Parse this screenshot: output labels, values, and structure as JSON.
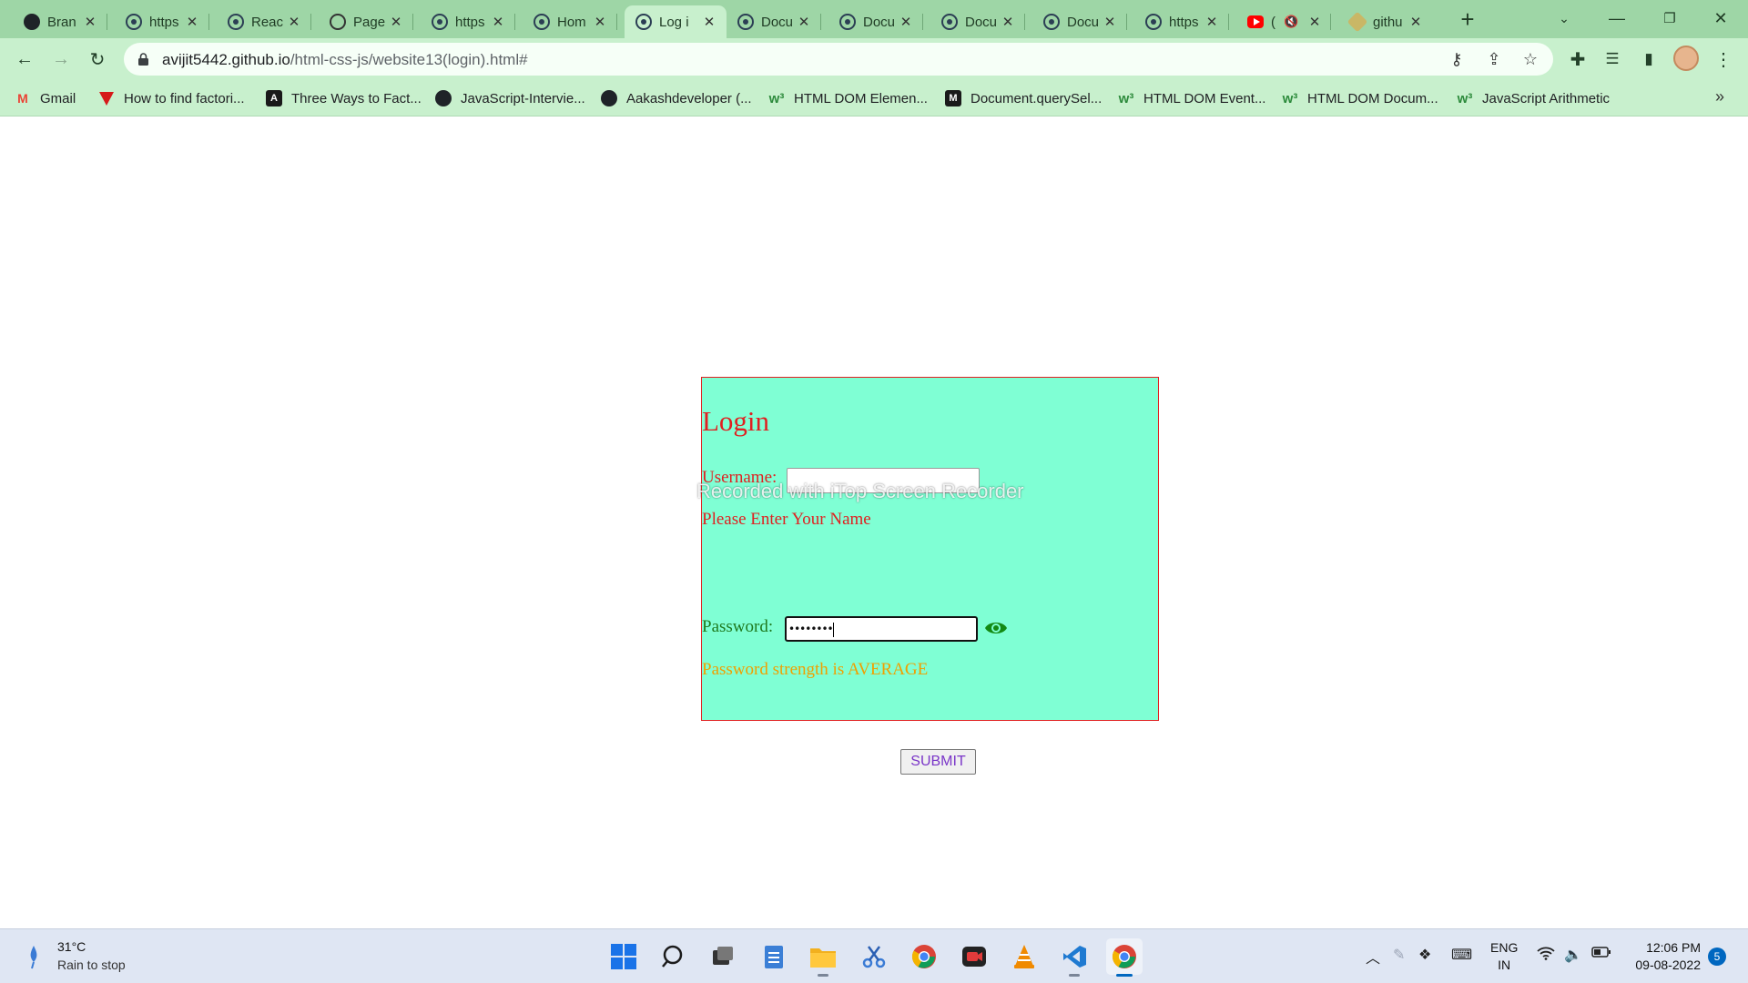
{
  "browser": {
    "tabs": [
      {
        "title": "Bran",
        "icon": "github-icon"
      },
      {
        "title": "https",
        "icon": "react-icon"
      },
      {
        "title": "Reac",
        "icon": "react-icon"
      },
      {
        "title": "Page",
        "icon": "globe-icon"
      },
      {
        "title": "https",
        "icon": "react-icon"
      },
      {
        "title": "Hom",
        "icon": "react-icon"
      },
      {
        "title": "Log i",
        "icon": "react-icon",
        "active": true
      },
      {
        "title": "Docu",
        "icon": "react-icon"
      },
      {
        "title": "Docu",
        "icon": "react-icon"
      },
      {
        "title": "Docu",
        "icon": "react-icon"
      },
      {
        "title": "Docu",
        "icon": "react-icon"
      },
      {
        "title": "https",
        "icon": "react-icon"
      },
      {
        "title": "(",
        "icon": "youtube-icon",
        "muted": true
      },
      {
        "title": "githu",
        "icon": "git-icon"
      }
    ],
    "new_tab": "+",
    "url_host": "avijit5442.github.io",
    "url_path": "/html-css-js/website13(login).html#",
    "bookmarks": [
      {
        "label": "Gmail",
        "icon": "gmail-icon"
      },
      {
        "label": "How to find factori...",
        "icon": "topcoder-icon"
      },
      {
        "label": "Three Ways to Fact...",
        "icon": "freecodecamp-icon"
      },
      {
        "label": "JavaScript-Intervie...",
        "icon": "github-icon"
      },
      {
        "label": "Aakashdeveloper (...",
        "icon": "github-icon"
      },
      {
        "label": "HTML DOM Elemen...",
        "icon": "w3schools-icon"
      },
      {
        "label": "Document.querySel...",
        "icon": "mdn-icon"
      },
      {
        "label": "HTML DOM Event...",
        "icon": "w3schools-icon"
      },
      {
        "label": "HTML DOM Docum...",
        "icon": "w3schools-icon"
      },
      {
        "label": "JavaScript Arithmetic",
        "icon": "w3schools-icon"
      }
    ]
  },
  "login": {
    "title": "Login",
    "username_label": "Username:",
    "username_value": "",
    "name_error": "Please Enter Your Name",
    "password_label": "Password:",
    "password_value": "••••••••",
    "strength_message": "Password strength is AVERAGE",
    "submit_label": "SUBMIT",
    "watermark": "Recorded with iTop Screen Recorder"
  },
  "taskbar": {
    "weather_temp": "31°C",
    "weather_desc": "Rain to stop",
    "lang_top": "ENG",
    "lang_bottom": "IN",
    "time": "12:06 PM",
    "date": "09-08-2022",
    "notifications": "5"
  },
  "colors": {
    "tab_strip": "#9ed6a6",
    "toolbar": "#c8f0cd",
    "login_bg": "#7fffd4",
    "login_border": "#e02020",
    "error_red": "#e02020",
    "password_green": "#1f7a1f",
    "strength_orange": "#f0a000",
    "submit_text": "#7a35c8"
  }
}
